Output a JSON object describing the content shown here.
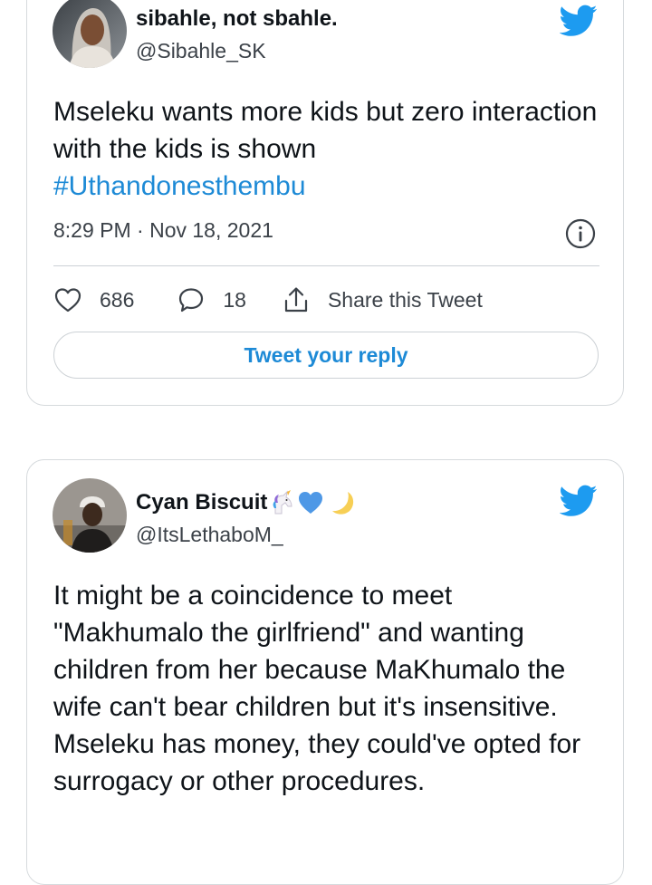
{
  "tweets": [
    {
      "display_name": "sibahle, not sbahle.",
      "handle": "@Sibahle_SK",
      "text": "Mseleku wants more kids but zero interaction with the kids is shown",
      "hashtag": "#Uthandonesthembu",
      "timestamp": "8:29 PM · Nov 18, 2021",
      "likes": "686",
      "replies": "18",
      "share_label": "Share this Tweet",
      "reply_button_label": "Tweet your reply"
    },
    {
      "display_name": "Cyan Biscuit",
      "name_emojis": [
        "unicorn-emoji",
        "blue-heart-emoji",
        "crescent-moon-emoji"
      ],
      "handle": "@ItsLethaboM_",
      "text": "It might be a coincidence to meet \"Makhumalo the girlfriend\" and wanting children from her because MaKhumalo the wife can't bear children but it's insensitive. Mseleku has money, they could've opted for surrogacy or other procedures."
    }
  ],
  "icons": {
    "brand": "twitter-bird-icon",
    "info": "info-icon",
    "like": "heart-icon",
    "reply": "comment-icon",
    "share": "share-icon"
  },
  "colors": {
    "brand_blue": "#1d9bf0",
    "link_blue": "#1d8ad6",
    "text_primary": "#0f1419",
    "text_secondary": "#3b4148",
    "border": "#d6dadd"
  }
}
